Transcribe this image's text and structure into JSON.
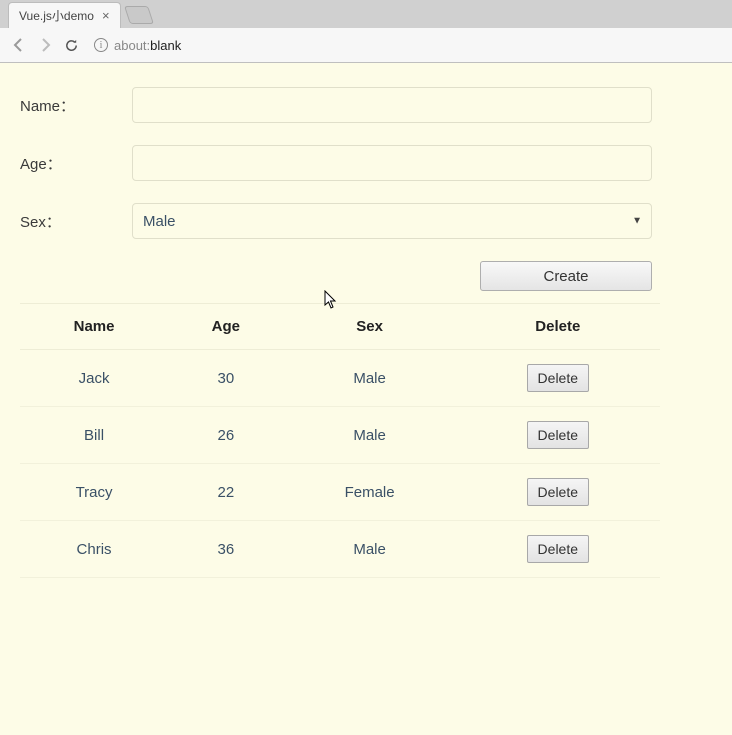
{
  "browser": {
    "tab_title": "Vue.js小demo",
    "url_protocol": "about:",
    "url_host": "blank"
  },
  "form": {
    "name_label": "Name：",
    "name_value": "",
    "age_label": "Age：",
    "age_value": "",
    "sex_label": "Sex：",
    "sex_selected": "Male",
    "create_label": "Create"
  },
  "table": {
    "headers": {
      "name": "Name",
      "age": "Age",
      "sex": "Sex",
      "delete": "Delete"
    },
    "delete_label": "Delete",
    "rows": [
      {
        "name": "Jack",
        "age": "30",
        "sex": "Male"
      },
      {
        "name": "Bill",
        "age": "26",
        "sex": "Male"
      },
      {
        "name": "Tracy",
        "age": "22",
        "sex": "Female"
      },
      {
        "name": "Chris",
        "age": "36",
        "sex": "Male"
      }
    ]
  }
}
